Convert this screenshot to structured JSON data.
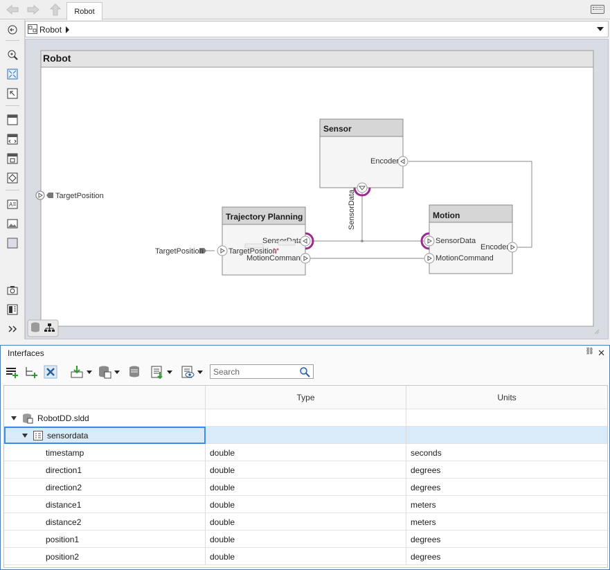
{
  "window": {
    "tab_label": "Robot",
    "breadcrumb": "Robot"
  },
  "diagram": {
    "root_title": "Robot",
    "root_port": "TargetPosition",
    "components": [
      {
        "name": "Sensor",
        "ports": [
          "Encoder"
        ]
      },
      {
        "name": "Trajectory Planning",
        "ports": [
          "SensorData",
          "TargetPosition",
          "MotionCommand"
        ]
      },
      {
        "name": "Motion",
        "ports": [
          "SensorData",
          "Encoder",
          "MotionCommand"
        ]
      }
    ],
    "external_port_label": "TargetPosition",
    "vertical_port_label": "SensorData"
  },
  "interfaces": {
    "panel_title": "Interfaces",
    "search_placeholder": "Search",
    "columns": [
      "",
      "Type",
      "Units"
    ],
    "dictionary": "RobotDD.sldd",
    "interface": "sensordata",
    "rows": [
      {
        "name": "timestamp",
        "type": "double",
        "units": "seconds"
      },
      {
        "name": "direction1",
        "type": "double",
        "units": "degrees"
      },
      {
        "name": "direction2",
        "type": "double",
        "units": "degrees"
      },
      {
        "name": "distance1",
        "type": "double",
        "units": "meters"
      },
      {
        "name": "distance2",
        "type": "double",
        "units": "meters"
      },
      {
        "name": "position1",
        "type": "double",
        "units": "degrees"
      },
      {
        "name": "position2",
        "type": "double",
        "units": "degrees"
      }
    ]
  },
  "colors": {
    "port_accent": "#9b2c8f",
    "selection": "#d9ebf8",
    "focus": "#3d8ee2"
  }
}
